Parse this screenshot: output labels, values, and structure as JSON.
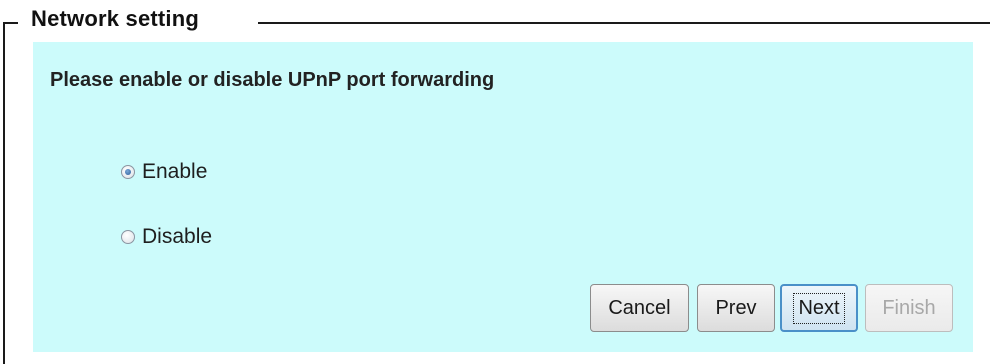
{
  "fieldset": {
    "legend": "Network setting"
  },
  "panel": {
    "instruction": "Please enable or disable UPnP port forwarding",
    "options": [
      {
        "label": "Enable",
        "checked": true
      },
      {
        "label": "Disable",
        "checked": false
      }
    ]
  },
  "buttons": {
    "cancel": "Cancel",
    "prev": "Prev",
    "next": "Next",
    "finish": "Finish",
    "finish_enabled": false
  },
  "colors": {
    "panel_background": "#ccfbfb",
    "focus_border": "#4a90c8",
    "disabled_text": "#a8a8a8"
  }
}
